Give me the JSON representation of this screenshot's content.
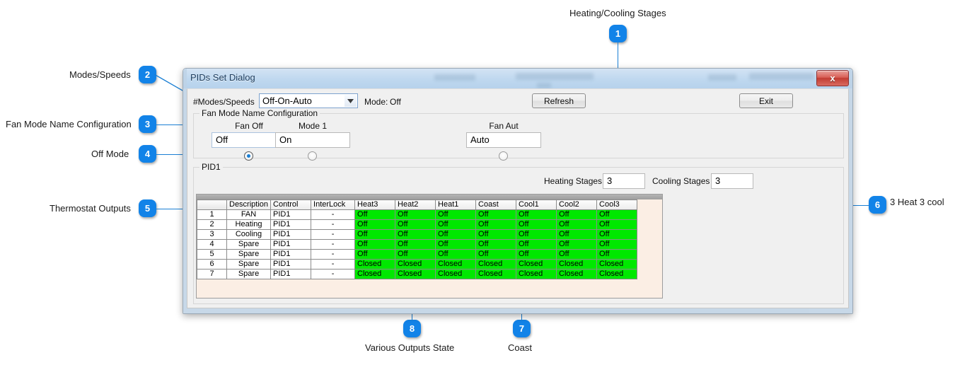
{
  "annotations": [
    {
      "num": "1",
      "label": "Heating/Cooling Stages"
    },
    {
      "num": "2",
      "label": "Modes/Speeds"
    },
    {
      "num": "3",
      "label": "Fan Mode Name Configuration"
    },
    {
      "num": "4",
      "label": "Off Mode"
    },
    {
      "num": "5",
      "label": "Thermostat Outputs"
    },
    {
      "num": "6",
      "label": "3 Heat 3 cool"
    },
    {
      "num": "7",
      "label": "Coast"
    },
    {
      "num": "8",
      "label": "Various Outputs State"
    }
  ],
  "dialog": {
    "title": "PIDs Set Dialog",
    "close_label": "x",
    "modes_label": "#Modes/Speeds",
    "modes_value": "Off-On-Auto",
    "mode_label": "Mode:",
    "mode_value": "Off",
    "refresh_label": "Refresh",
    "exit_label": "Exit",
    "fan_group_title": "Fan Mode Name Configuration",
    "fan_fields": [
      {
        "header": "Fan Off",
        "value": "Off",
        "selected": true
      },
      {
        "header": "Mode 1",
        "value": "On",
        "selected": false
      },
      {
        "header": "Fan Aut",
        "value": "Auto",
        "selected": false
      }
    ],
    "pid_group_title": "PID1",
    "heating_stages_label": "Heating Stages",
    "heating_stages_value": "3",
    "cooling_stages_label": "Cooling Stages",
    "cooling_stages_value": "3"
  },
  "grid": {
    "columns": [
      "",
      "Description",
      "Control",
      "InterLock",
      "Heat3",
      "Heat2",
      "Heat1",
      "Coast",
      "Cool1",
      "Cool2",
      "Cool3"
    ],
    "rows": [
      {
        "idx": "1",
        "description": "FAN",
        "control": "PID1",
        "interlock": "-",
        "states": [
          "Off",
          "Off",
          "Off",
          "Off",
          "Off",
          "Off",
          "Off"
        ]
      },
      {
        "idx": "2",
        "description": "Heating",
        "control": "PID1",
        "interlock": "-",
        "states": [
          "Off",
          "Off",
          "Off",
          "Off",
          "Off",
          "Off",
          "Off"
        ]
      },
      {
        "idx": "3",
        "description": "Cooling",
        "control": "PID1",
        "interlock": "-",
        "states": [
          "Off",
          "Off",
          "Off",
          "Off",
          "Off",
          "Off",
          "Off"
        ]
      },
      {
        "idx": "4",
        "description": "Spare",
        "control": "PID1",
        "interlock": "-",
        "states": [
          "Off",
          "Off",
          "Off",
          "Off",
          "Off",
          "Off",
          "Off"
        ]
      },
      {
        "idx": "5",
        "description": "Spare",
        "control": "PID1",
        "interlock": "-",
        "states": [
          "Off",
          "Off",
          "Off",
          "Off",
          "Off",
          "Off",
          "Off"
        ]
      },
      {
        "idx": "6",
        "description": "Spare",
        "control": "PID1",
        "interlock": "-",
        "states": [
          "Closed",
          "Closed",
          "Closed",
          "Closed",
          "Closed",
          "Closed",
          "Closed"
        ]
      },
      {
        "idx": "7",
        "description": "Spare",
        "control": "PID1",
        "interlock": "-",
        "states": [
          "Closed",
          "Closed",
          "Closed",
          "Closed",
          "Closed",
          "Closed",
          "Closed"
        ]
      }
    ]
  },
  "colors": {
    "callout_blue": "#1283e8",
    "leader_blue": "#1a7fd4",
    "state_green": "#00e800",
    "grid_background": "#fbeee4",
    "close_red": "#c23d33"
  }
}
